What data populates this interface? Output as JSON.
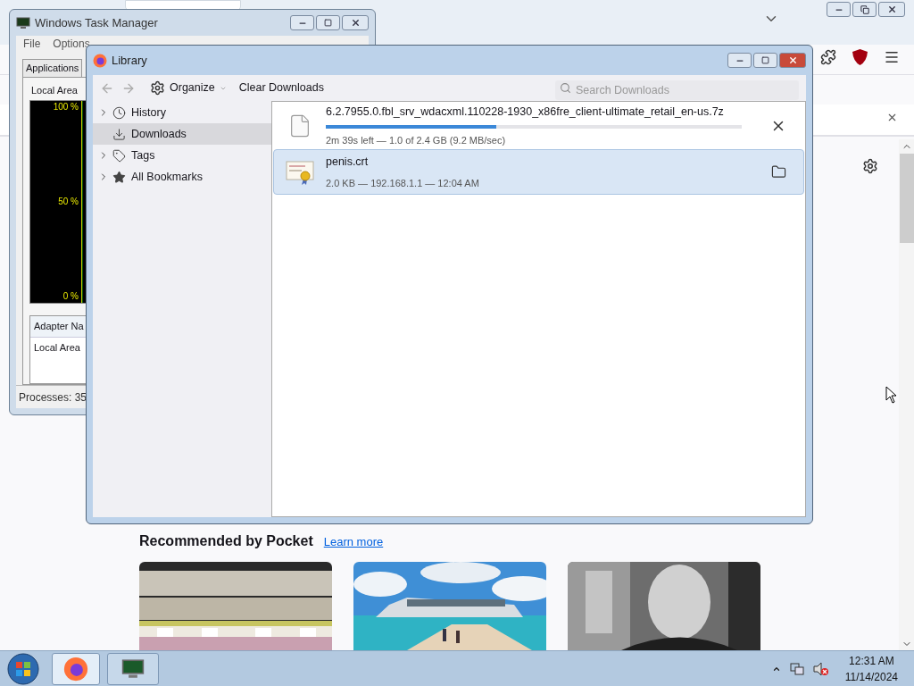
{
  "firefox": {
    "pocket": {
      "heading": "Recommended by Pocket",
      "link": "Learn more",
      "cards": [
        {
          "kind": "shelves"
        },
        {
          "kind": "ship"
        },
        {
          "kind": "speaker"
        }
      ]
    }
  },
  "task_manager": {
    "title": "Windows Task Manager",
    "menu": [
      "File",
      "Options"
    ],
    "tabs": [
      {
        "label": "Applications",
        "selected": false
      }
    ],
    "graph_title": "Local Area",
    "graph_labels": [
      "100 %",
      "50 %",
      "0 %"
    ],
    "table": {
      "column": "Adapter Na",
      "row": "Local Area"
    },
    "status": "Processes: 35"
  },
  "library": {
    "title": "Library",
    "organize": "Organize",
    "clear": "Clear Downloads",
    "search_placeholder": "Search Downloads",
    "sidebar": [
      {
        "label": "History",
        "kind": "clock",
        "expandable": true,
        "selected": false
      },
      {
        "label": "Downloads",
        "kind": "download",
        "expandable": false,
        "selected": true
      },
      {
        "label": "Tags",
        "kind": "tag",
        "expandable": true,
        "selected": false
      },
      {
        "label": "All Bookmarks",
        "kind": "star",
        "expandable": true,
        "selected": false
      }
    ],
    "downloads": [
      {
        "kind": "progress",
        "name": "6.2.7955.0.fbl_srv_wdacxml.110228-1930_x86fre_client-ultimate_retail_en-us.7z",
        "status": "2m 39s left — 1.0 of 2.4 GB (9.2 MB/sec)",
        "level": 0.41,
        "selected": false
      },
      {
        "kind": "done",
        "name": "penis.crt",
        "status": "2.0 KB — 192.168.1.1 — 12:04 AM",
        "selected": true
      }
    ]
  },
  "taskbar": {
    "buttons": [
      {
        "kind": "firefox",
        "selected": true
      },
      {
        "kind": "task-manager",
        "selected": false
      }
    ],
    "time": "12:31 AM",
    "date": "11/14/2024"
  }
}
